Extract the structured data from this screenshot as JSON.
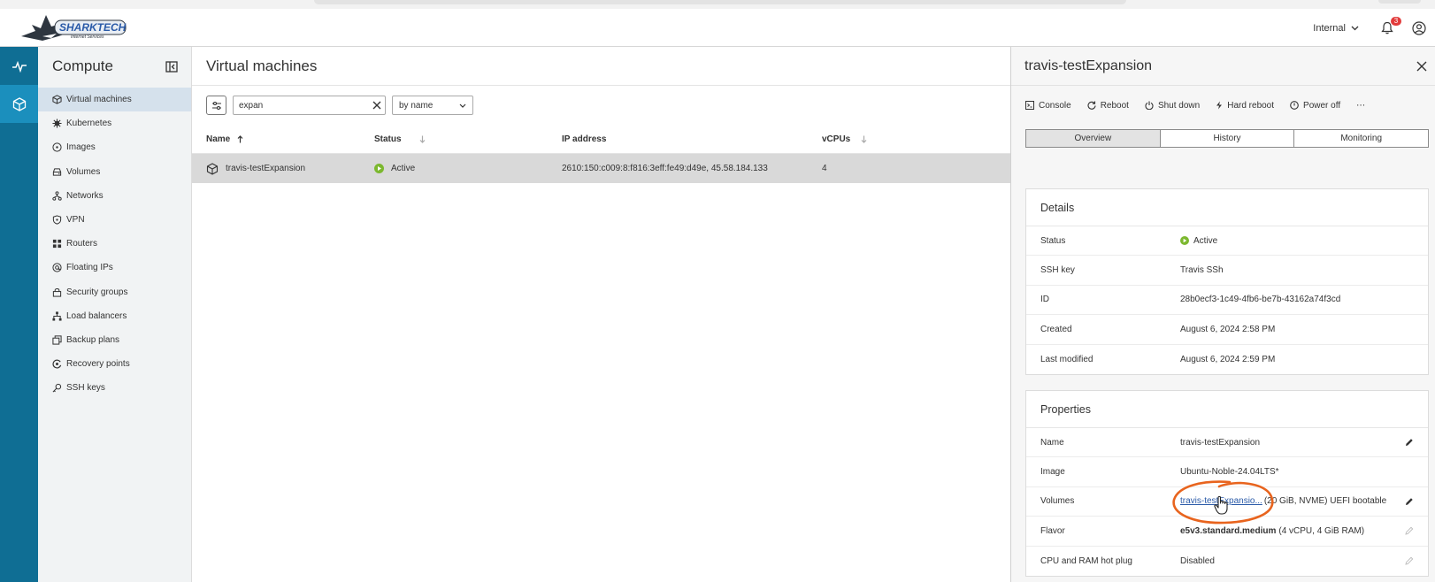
{
  "topbar": {
    "brand": "SHARKTECH",
    "brand_sub": "Internet Services",
    "org": "Internal",
    "notification_count": "3"
  },
  "sidebar": {
    "title": "Compute",
    "items": [
      {
        "label": "Virtual machines",
        "icon": "cube-icon",
        "active": true
      },
      {
        "label": "Kubernetes",
        "icon": "kubernetes-icon"
      },
      {
        "label": "Images",
        "icon": "image-disc-icon"
      },
      {
        "label": "Volumes",
        "icon": "volume-icon"
      },
      {
        "label": "Networks",
        "icon": "network-icon"
      },
      {
        "label": "VPN",
        "icon": "shield-icon"
      },
      {
        "label": "Routers",
        "icon": "router-icon"
      },
      {
        "label": "Floating IPs",
        "icon": "floating-ip-icon"
      },
      {
        "label": "Security groups",
        "icon": "lock-icon"
      },
      {
        "label": "Load balancers",
        "icon": "load-balancer-icon"
      },
      {
        "label": "Backup plans",
        "icon": "backup-icon"
      },
      {
        "label": "Recovery points",
        "icon": "recovery-icon"
      },
      {
        "label": "SSH keys",
        "icon": "key-icon"
      }
    ]
  },
  "main": {
    "title": "Virtual machines",
    "search": {
      "value": "expan"
    },
    "sort": {
      "selected": "by name"
    },
    "columns": {
      "name": "Name",
      "status": "Status",
      "ip": "IP address",
      "vcpus": "vCPUs"
    },
    "rows": [
      {
        "name": "travis-testExpansion",
        "status": "Active",
        "ip": "2610:150:c009:8:f816:3eff:fe49:d49e, 45.58.184.133",
        "vcpus": "4"
      }
    ]
  },
  "panel": {
    "title": "travis-testExpansion",
    "actions": {
      "console": "Console",
      "reboot": "Reboot",
      "shutdown": "Shut down",
      "hard_reboot": "Hard reboot",
      "power_off": "Power off",
      "more": "⋯"
    },
    "tabs": {
      "overview": "Overview",
      "history": "History",
      "monitoring": "Monitoring"
    },
    "details": {
      "title": "Details",
      "status_label": "Status",
      "status_value": "Active",
      "ssh_label": "SSH key",
      "ssh_value": "Travis SSh",
      "id_label": "ID",
      "id_value": "28b0ecf3-1c49-4fb6-be7b-43162a74f3cd",
      "created_label": "Created",
      "created_value": "August 6, 2024 2:58 PM",
      "modified_label": "Last modified",
      "modified_value": "August 6, 2024 2:59 PM"
    },
    "properties": {
      "title": "Properties",
      "name_label": "Name",
      "name_value": "travis-testExpansion",
      "image_label": "Image",
      "image_value": "Ubuntu-Noble-24.04LTS*",
      "volumes_label": "Volumes",
      "volumes_link": "travis-testExpansio...",
      "volumes_detail": "(20 GiB, NVME) UEFI bootable",
      "flavor_label": "Flavor",
      "flavor_name": "e5v3.standard.medium",
      "flavor_detail": "(4 vCPU, 4 GiB RAM)",
      "hotplug_label": "CPU and RAM hot plug",
      "hotplug_value": "Disabled"
    }
  },
  "colors": {
    "rail": "#0f6e94",
    "rail_active": "#1b8fbd",
    "status_active": "#7cb82f",
    "annotation": "#e8641e",
    "link": "#2a5aa8"
  }
}
